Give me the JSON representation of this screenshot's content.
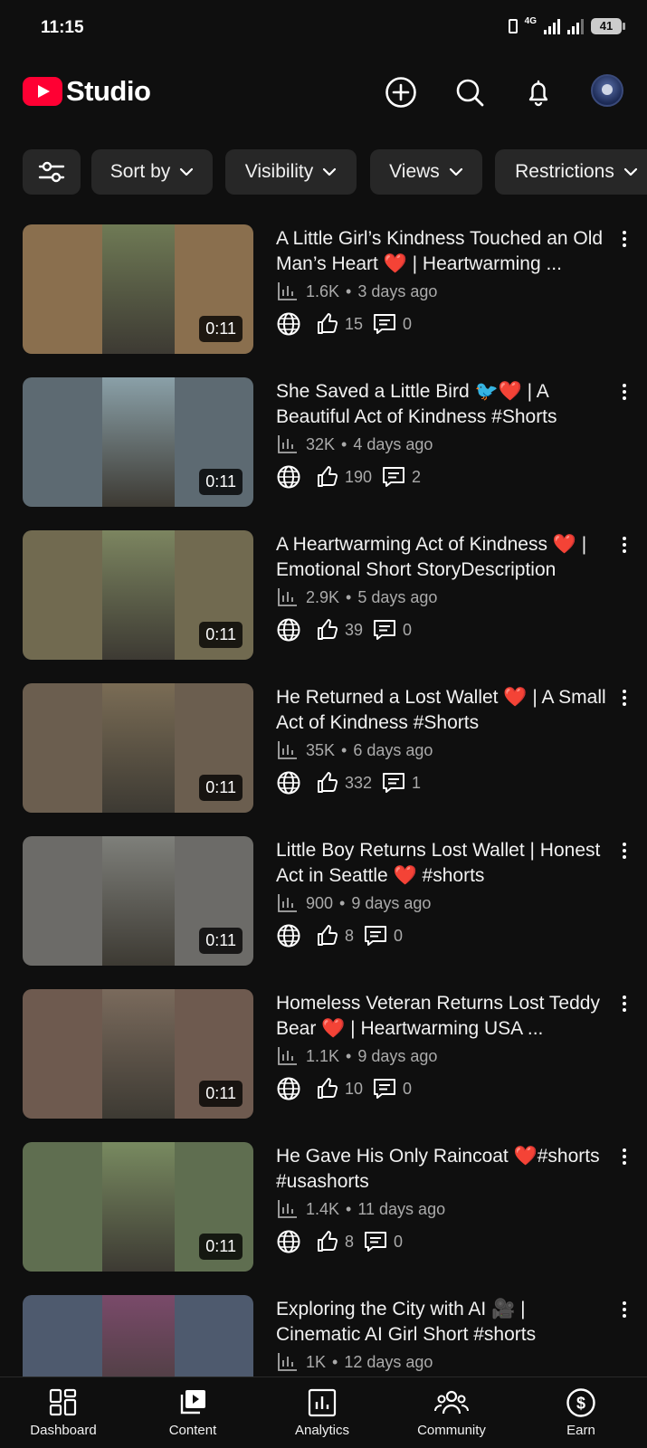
{
  "status_bar": {
    "time": "11:15",
    "network": "4G",
    "battery": "41"
  },
  "header": {
    "logo_text": "Studio",
    "brand_color": "#ff0033",
    "icons": [
      "add-circle-icon",
      "search-icon",
      "bell-icon",
      "avatar"
    ]
  },
  "filters": {
    "chips": [
      {
        "label": "Sort by"
      },
      {
        "label": "Visibility"
      },
      {
        "label": "Views"
      },
      {
        "label": "Restrictions"
      }
    ]
  },
  "videos": [
    {
      "title": "A Little Girl’s Kindness Touched an Old Man’s Heart ❤️ | Heartwarming ...",
      "views": "1.6K",
      "age": "3 days ago",
      "likes": "15",
      "comments": "0",
      "duration": "0:11",
      "bg": "#8a6f4e",
      "center": "#6f7a55"
    },
    {
      "title": "She Saved a Little Bird 🐦❤️ | A Beautiful Act of Kindness #Shorts",
      "views": "32K",
      "age": "4 days ago",
      "likes": "190",
      "comments": "2",
      "duration": "0:11",
      "bg": "#5d6a72",
      "center": "#8aa0a8"
    },
    {
      "title": "A Heartwarming Act of Kindness ❤️ | Emotional Short StoryDescription",
      "views": "2.9K",
      "age": "5 days ago",
      "likes": "39",
      "comments": "0",
      "duration": "0:11",
      "bg": "#716a50",
      "center": "#7c8560"
    },
    {
      "title": "He Returned a Lost Wallet ❤️ | A Small Act of Kindness #Shorts",
      "views": "35K",
      "age": "6 days ago",
      "likes": "332",
      "comments": "1",
      "duration": "0:11",
      "bg": "#6b5e4f",
      "center": "#7a6c55"
    },
    {
      "title": "Little Boy Returns Lost Wallet | Honest Act in Seattle ❤️ #shorts",
      "views": "900",
      "age": "9 days ago",
      "likes": "8",
      "comments": "0",
      "duration": "0:11",
      "bg": "#6c6b68",
      "center": "#7e7f7a"
    },
    {
      "title": "Homeless Veteran Returns Lost Teddy Bear ❤️ | Heartwarming USA ...",
      "views": "1.1K",
      "age": "9 days ago",
      "likes": "10",
      "comments": "0",
      "duration": "0:11",
      "bg": "#6e5a4f",
      "center": "#7a6a5c"
    },
    {
      "title": "He Gave His Only Raincoat ❤️#shorts #usashorts",
      "views": "1.4K",
      "age": "11 days ago",
      "likes": "8",
      "comments": "0",
      "duration": "0:11",
      "bg": "#5f6e50",
      "center": "#788a60"
    },
    {
      "title": "Exploring the City with AI 🎥 | Cinematic AI Girl Short #shorts",
      "views": "1K",
      "age": "12 days ago",
      "likes": "",
      "comments": "",
      "duration": "",
      "bg": "#4e5a6e",
      "center": "#7a4a6a"
    }
  ],
  "bottom_nav": {
    "items": [
      {
        "label": "Dashboard",
        "icon": "dashboard-icon"
      },
      {
        "label": "Content",
        "icon": "content-icon"
      },
      {
        "label": "Analytics",
        "icon": "analytics-icon"
      },
      {
        "label": "Community",
        "icon": "community-icon"
      },
      {
        "label": "Earn",
        "icon": "earn-icon"
      }
    ]
  }
}
